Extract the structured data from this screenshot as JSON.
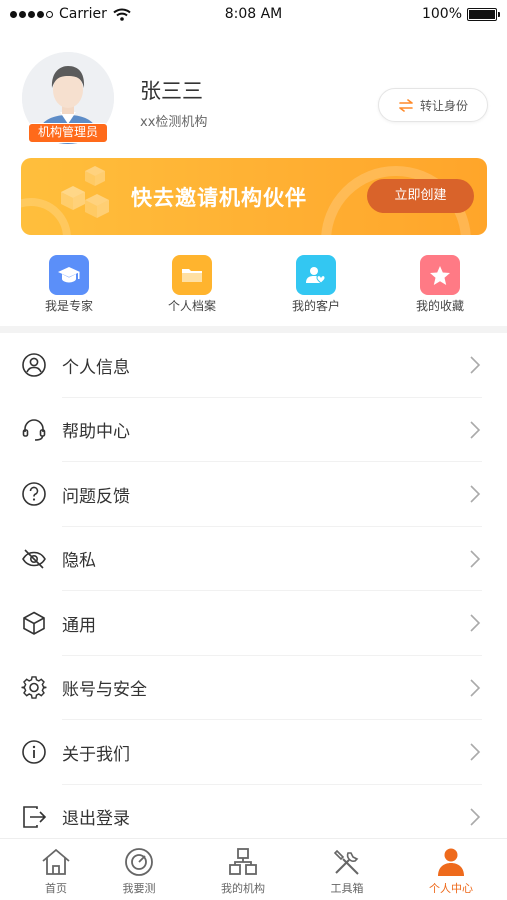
{
  "status_bar": {
    "carrier": "Carrier",
    "time": "8:08 AM",
    "battery": "100%"
  },
  "profile": {
    "name": "张三三",
    "organization": "xx检测机构",
    "role_badge": "机构管理员",
    "switch_identity_label": "转让身份"
  },
  "banner": {
    "title": "快去邀请机构伙伴",
    "button_label": "立即创建",
    "colors": {
      "from": "#ffbf3c",
      "to": "#ffa52a",
      "button": "#d9632a"
    }
  },
  "quick_actions": [
    {
      "label": "我是专家",
      "icon": "graduation-cap-icon",
      "color": "#5b8ff9"
    },
    {
      "label": "个人档案",
      "icon": "folder-icon",
      "color": "#ffb42e"
    },
    {
      "label": "我的客户",
      "icon": "customer-icon",
      "color": "#33c7f2"
    },
    {
      "label": "我的收藏",
      "icon": "star-icon",
      "color": "#ff7a85"
    }
  ],
  "menu": {
    "items": [
      {
        "label": "个人信息",
        "icon": "user-circle-icon"
      },
      {
        "label": "帮助中心",
        "icon": "headset-icon"
      },
      {
        "label": "问题反馈",
        "icon": "question-circle-icon"
      },
      {
        "label": "隐私",
        "icon": "eye-off-icon"
      },
      {
        "label": "通用",
        "icon": "cube-icon"
      },
      {
        "label": "账号与安全",
        "icon": "gear-icon"
      },
      {
        "label": "关于我们",
        "icon": "info-circle-icon"
      },
      {
        "label": "退出登录",
        "icon": "logout-icon"
      }
    ]
  },
  "tabbar": {
    "items": [
      {
        "label": "首页",
        "icon": "home-icon"
      },
      {
        "label": "我要测",
        "icon": "target-icon"
      },
      {
        "label": "我的机构",
        "icon": "organization-icon"
      },
      {
        "label": "工具箱",
        "icon": "tools-icon"
      },
      {
        "label": "个人中心",
        "icon": "person-icon"
      }
    ],
    "active_index": 4,
    "active_color": "#ee6a1c"
  }
}
